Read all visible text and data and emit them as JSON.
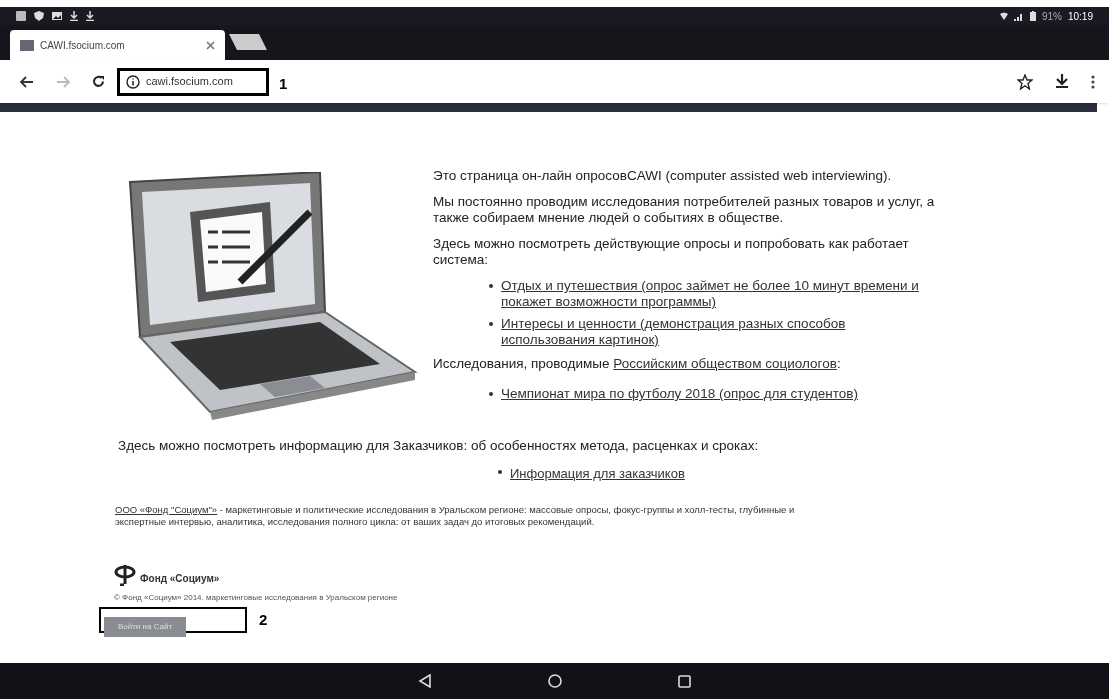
{
  "status_bar": {
    "battery": "91%",
    "time": "10:19"
  },
  "tabs": [
    {
      "title": "CAWI.fsocium.com",
      "selected": true
    }
  ],
  "address_bar": {
    "url": "cawi.fsocium.com"
  },
  "toolbar": {
    "forward_disabled": true
  },
  "intro": [
    "Это страница он-лайн опросовCAWI (computer assisted web interviewing).",
    "Мы постоянно проводим исследования потребителей разных товаров и услуг, а также собираем мнение людей о событиях в обществе.",
    "Здесь  можно посмотреть действующие опросы и попробовать как работает система:"
  ],
  "demo_surveys": [
    "Отдых и путешествия (опрос займет не более 10 минут времени и покажет возможности программы)",
    "Интересы и ценности (демонстрация разных способов использования картинок)"
  ],
  "research_note": {
    "text": "Исследования, проводимые ",
    "link": "Российским обществом социологов",
    "after": ":"
  },
  "research_surveys": [
    "Чемпионат мира по футболу 2018 (опрос для студентов)"
  ],
  "clients_note": "Здесь можно посмотреть информацию для Заказчиков: об особенностях метода, расценках и сроках:",
  "clients_links": [
    "Информация для заказчиков"
  ],
  "about": {
    "link": "ООО «Фонд \"Социум\"»",
    "text": "  -  маркетинговые и политические исследования в Уральском регионе: массовые опросы, фокус-группы и холл-тесты, глубинные и экспертные интервью, аналитика,  исследования полного цикла: от ваших задач до итоговых рекомендаций."
  },
  "footer": {
    "logo_text": "Фонд «Социум»",
    "copyright": "© Фонд «Социум» 2014. маркетинговые исследования в Уральском регионе",
    "login_button": "Войти на Сайт"
  },
  "callouts": [
    {
      "number": "1"
    },
    {
      "number": "2"
    }
  ]
}
